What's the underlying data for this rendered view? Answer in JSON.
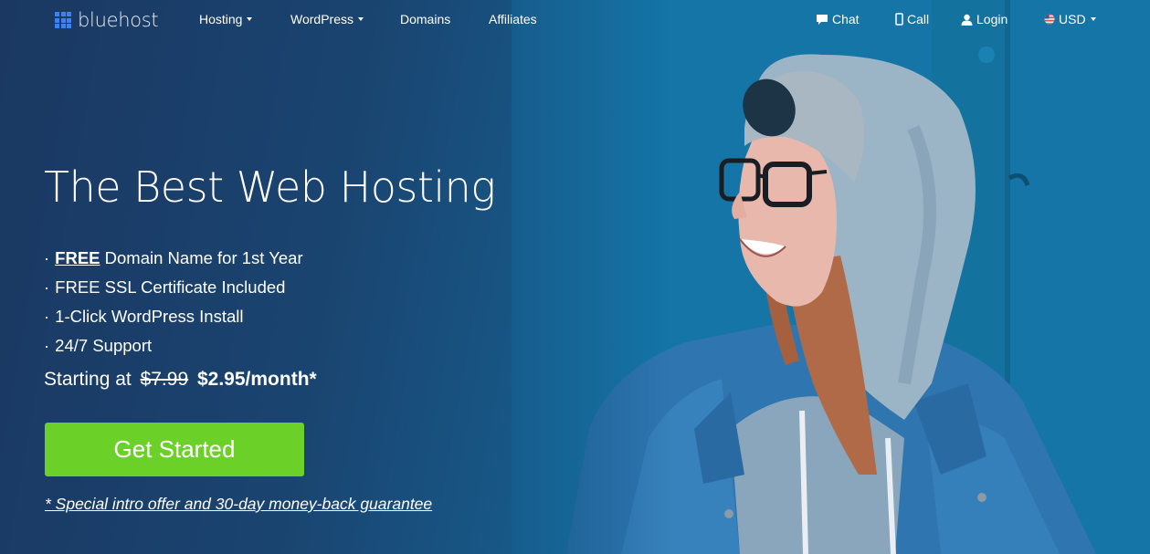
{
  "brand": {
    "name": "bluehost",
    "logo_color": "#3b82f6"
  },
  "nav": {
    "left": [
      {
        "label": "Hosting",
        "has_dropdown": true
      },
      {
        "label": "WordPress",
        "has_dropdown": true
      },
      {
        "label": "Domains",
        "has_dropdown": false
      },
      {
        "label": "Affiliates",
        "has_dropdown": false
      }
    ],
    "right": [
      {
        "label": "Chat",
        "icon": "chat-bubble-icon"
      },
      {
        "label": "Call",
        "icon": "mobile-phone-icon"
      },
      {
        "label": "Login",
        "icon": "user-icon"
      },
      {
        "label": "USD",
        "icon": "us-flag-icon",
        "has_dropdown": true
      }
    ]
  },
  "hero": {
    "headline": "The Best Web Hosting",
    "features": [
      {
        "bullet": "·",
        "emphasis": "FREE",
        "text": " Domain Name for 1st Year"
      },
      {
        "bullet": "·",
        "text": "FREE SSL Certificate Included"
      },
      {
        "bullet": "·",
        "text": "1-Click WordPress Install"
      },
      {
        "bullet": "·",
        "text": "24/7 Support"
      }
    ],
    "price": {
      "prefix": "Starting at",
      "old_price": "$7.99",
      "new_price": "$2.95/month*"
    },
    "cta_label": "Get Started",
    "cta_color": "#6bd028",
    "offer_note": "* Special intro offer and 30-day money-back guarantee"
  },
  "image": {
    "description": "smiling-woman-in-hoodie-and-denim-jacket"
  }
}
